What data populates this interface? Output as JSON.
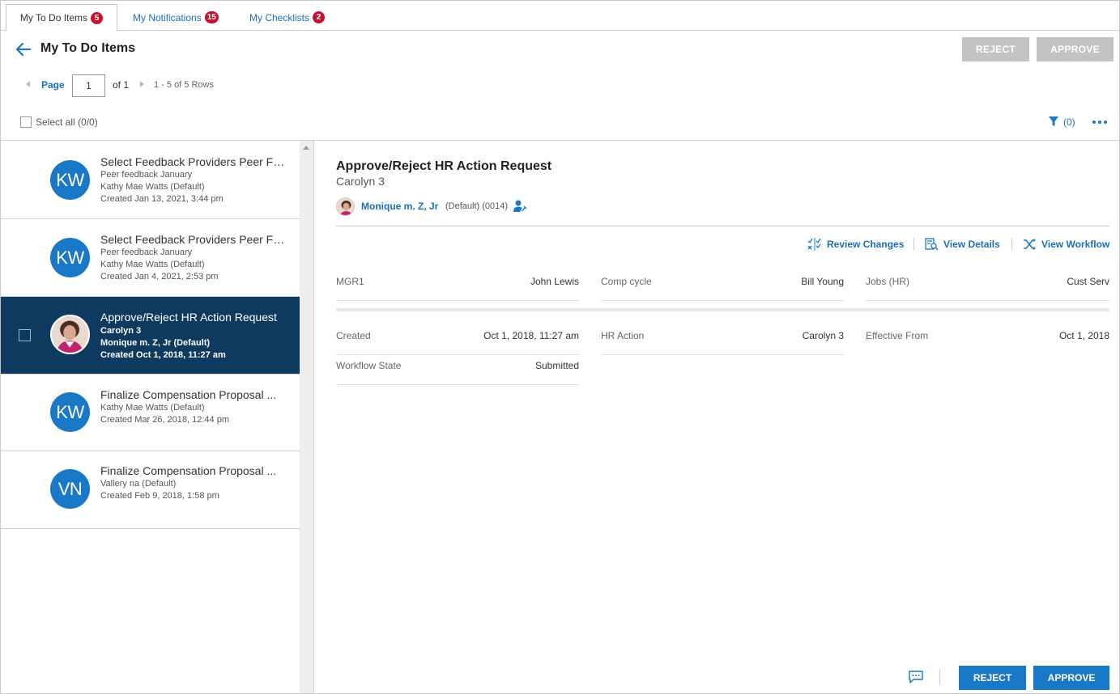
{
  "tabs": [
    {
      "label": "My To Do Items",
      "count": "5"
    },
    {
      "label": "My Notifications",
      "count": "15"
    },
    {
      "label": "My Checklists",
      "count": "2"
    }
  ],
  "header": {
    "title": "My To Do Items",
    "reject_label": "REJECT",
    "approve_label": "APPROVE"
  },
  "pager": {
    "page_label": "Page",
    "page_value": "1",
    "of_label": "of 1",
    "rows_label": "1 - 5 of 5 Rows"
  },
  "toolbar": {
    "select_all_label": "Select all (0/0)",
    "filter_count": "(0)"
  },
  "items": [
    {
      "initials": "KW",
      "title": "Select Feedback Providers Peer Feedback January",
      "line1": "Peer feedback January",
      "line2": "Kathy Mae Watts (Default)",
      "created_prefix": "Created ",
      "created": "Jan 13, 2021, 3:44 pm"
    },
    {
      "initials": "KW",
      "title": "Select Feedback Providers Peer Feedback January",
      "line1": "Peer feedback January",
      "line2": "Kathy Mae Watts (Default)",
      "created_prefix": "Created ",
      "created": "Jan 4, 2021, 2:53 pm"
    },
    {
      "initials": "",
      "title": "Approve/Reject HR Action Request",
      "line1": "Carolyn 3",
      "line2": "Monique m. Z, Jr (Default)",
      "created_prefix": "Created ",
      "created": "Oct 1, 2018, 11:27 am"
    },
    {
      "initials": "KW",
      "title": "Finalize Compensation Proposal ...",
      "line1": "Kathy Mae Watts (Default)",
      "created_prefix": "Created ",
      "created": "Mar 26, 2018, 12:44 pm"
    },
    {
      "initials": "VN",
      "title": "Finalize Compensation Proposal ...",
      "line1": "Vallery na (Default)",
      "created_prefix": "Created ",
      "created": "Feb 9, 2018, 1:58 pm"
    }
  ],
  "detail": {
    "title": "Approve/Reject HR Action Request",
    "subtitle": "Carolyn 3",
    "person_name": "Monique m. Z, Jr",
    "person_meta": "(Default) (0014)",
    "actions": {
      "review_changes": "Review Changes",
      "view_details": "View Details",
      "view_workflow": "View Workflow"
    },
    "fields_top": [
      {
        "label": "MGR1",
        "value": "John Lewis"
      },
      {
        "label": "Comp cycle",
        "value": "Bill Young"
      },
      {
        "label": "Jobs (HR)",
        "value": "Cust Serv"
      }
    ],
    "fields_bottom": [
      {
        "label": "Created",
        "value": "Oct 1, 2018, 11:27 am"
      },
      {
        "label": "HR Action",
        "value": "Carolyn 3"
      },
      {
        "label": "Effective From",
        "value": "Oct 1, 2018"
      },
      {
        "label": "Workflow State",
        "value": "Submitted"
      }
    ]
  },
  "footer": {
    "reject_label": "REJECT",
    "approve_label": "APPROVE"
  },
  "colors": {
    "accent": "#1a79c6",
    "link": "#1a6fb5",
    "selected_row": "#0f3a60",
    "badge": "#c8102e",
    "disabled_button": "#c3c3c3"
  }
}
